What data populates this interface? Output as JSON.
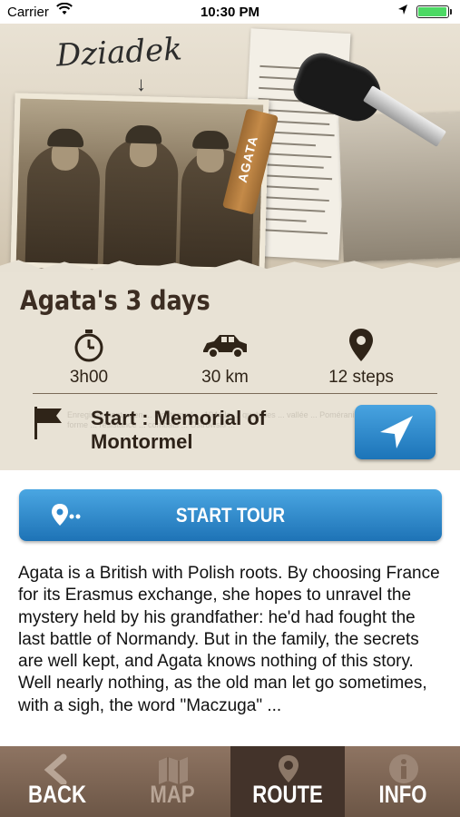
{
  "status_bar": {
    "carrier": "Carrier",
    "time": "10:30 PM",
    "battery_level": 1.0
  },
  "hero": {
    "title": "Dziadek",
    "tag_label": "AGATA"
  },
  "tour": {
    "title": "Agata's 3 days",
    "stats": [
      {
        "icon": "stopwatch-icon",
        "value": "3h00"
      },
      {
        "icon": "car-icon",
        "value": "30 km"
      },
      {
        "icon": "location-pin-icon",
        "value": "12 steps"
      }
    ],
    "start_line1": "Start : Memorial of",
    "start_line2": "Montormel"
  },
  "start_tour_button": {
    "label": "START TOUR"
  },
  "description": "Agata is a British with Polish roots. By choosing France for its Erasmus exchange, she hopes to unravel the mystery held by his grandfather: he'd had fought the last battle of Normandy. But in the family, the secrets are well kept, and Agata knows nothing of this story. Well nearly nothing, as the old man let go sometimes, with a sigh, the word \"Maczuga\" ...",
  "tabs": [
    {
      "label": "BACK",
      "icon": "back-arrow-icon"
    },
    {
      "label": "MAP",
      "icon": "map-icon"
    },
    {
      "label": "ROUTE",
      "icon": "route-pin-icon",
      "active": true
    },
    {
      "label": "INFO",
      "icon": "info-icon"
    }
  ],
  "colors": {
    "accent_blue": "#2b86cc",
    "tabbar_brown": "#7d6554",
    "active_tab": "#43332a",
    "title_brown": "#3c2d22"
  }
}
